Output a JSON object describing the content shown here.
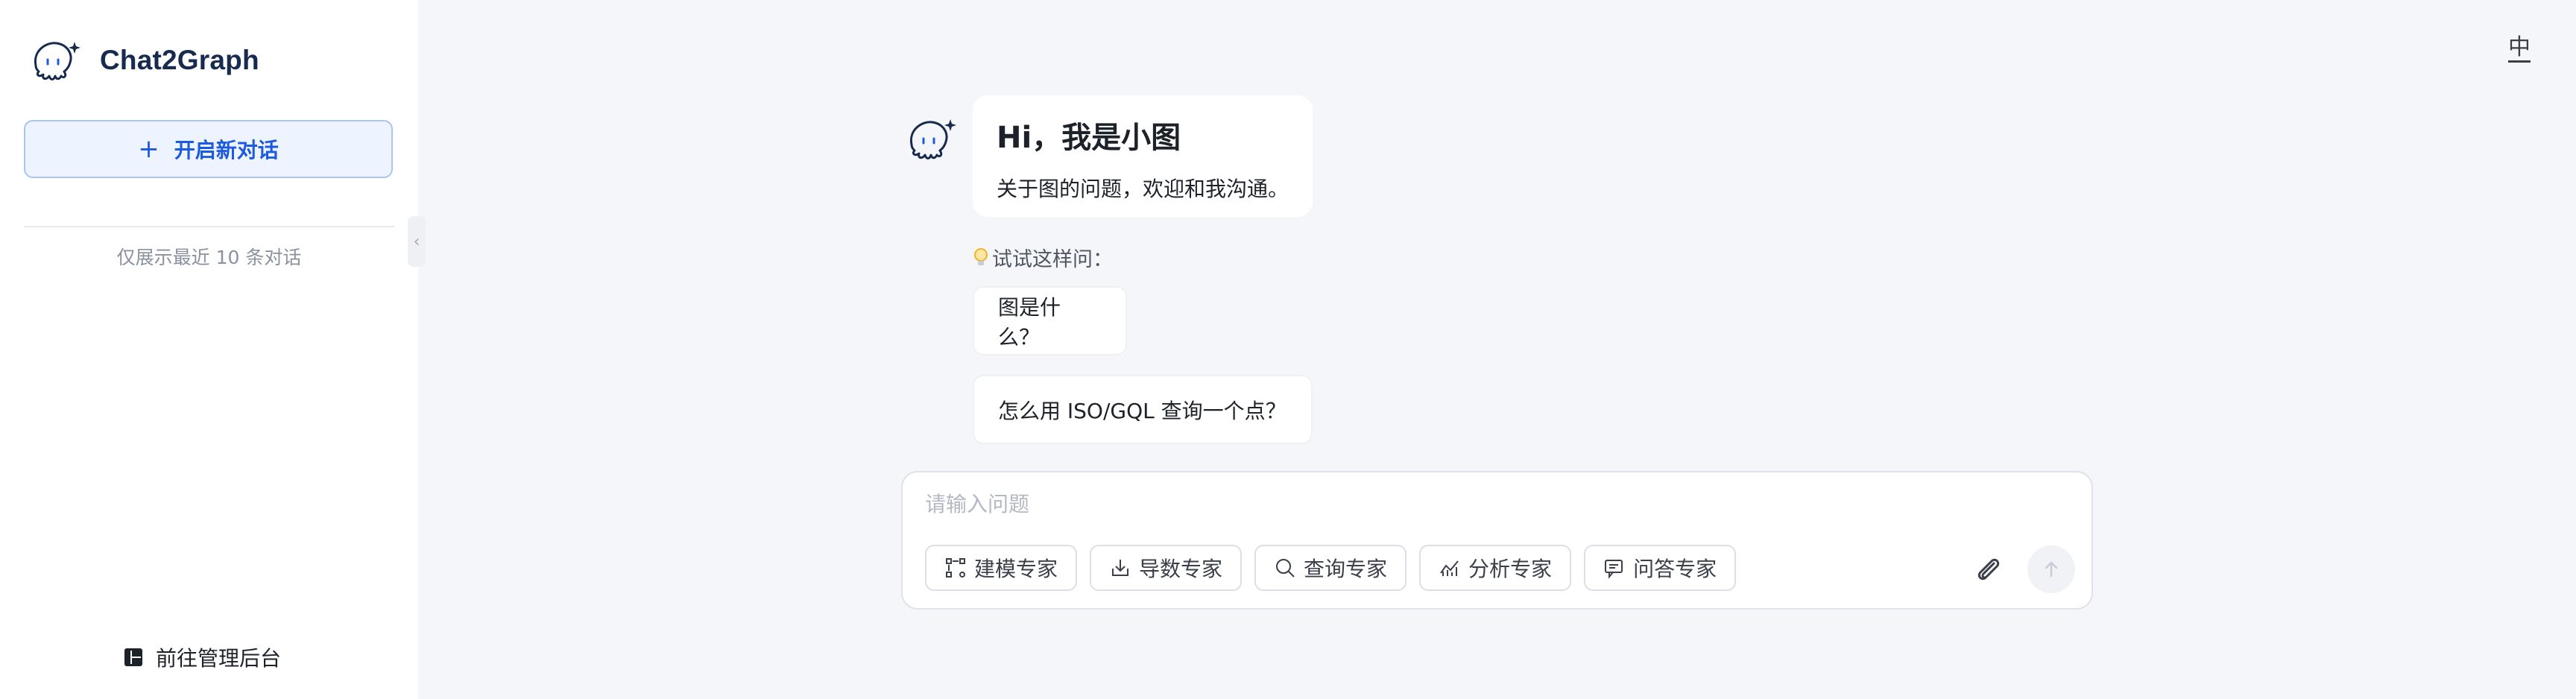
{
  "app": {
    "title": "Chat2Graph",
    "brand_color": "#172a4f",
    "accent": "#1d5ae0"
  },
  "sidebar": {
    "new_chat_label": "开启新对话",
    "recent_note": "仅展示最近 10 条对话",
    "admin_label": "前往管理后台"
  },
  "header": {
    "lang_toggle": "中"
  },
  "chat": {
    "greeting_title": "Hi，我是小图",
    "greeting_sub": "关于图的问题，欢迎和我沟通。",
    "try_label": "试试这样问：",
    "suggestions": [
      "图是什么？",
      "怎么用 ISO/GQL 查询一个点？"
    ]
  },
  "input": {
    "placeholder": "请输入问题",
    "experts": [
      {
        "label": "建模专家",
        "icon": "modeling-icon"
      },
      {
        "label": "导数专家",
        "icon": "import-icon"
      },
      {
        "label": "查询专家",
        "icon": "query-icon"
      },
      {
        "label": "分析专家",
        "icon": "analysis-icon"
      },
      {
        "label": "问答专家",
        "icon": "qa-icon"
      }
    ]
  }
}
